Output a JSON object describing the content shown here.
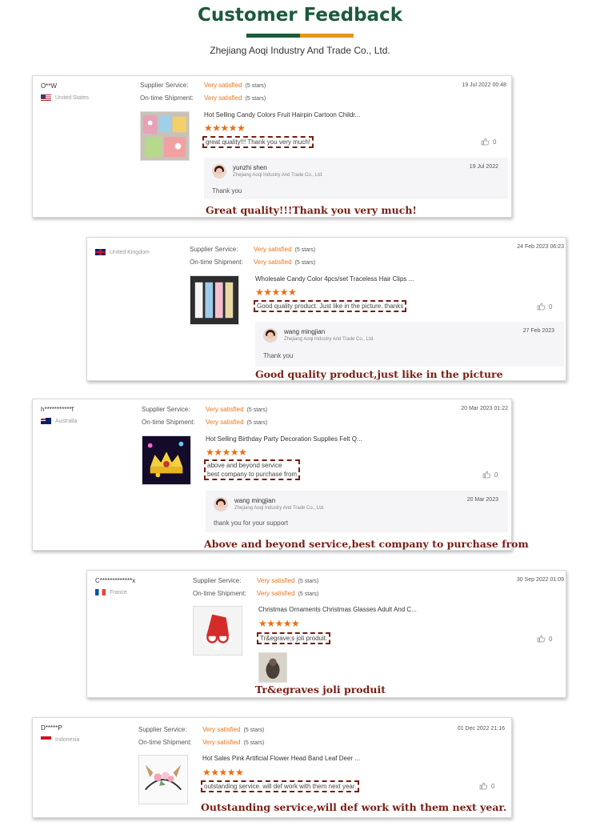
{
  "header": {
    "title": "Customer Feedback",
    "subtitle": "Zhejiang Aoqi Industry And Trade Co., Ltd.",
    "colors": {
      "green": "#1c5a3a",
      "orange": "#e8951e",
      "caption": "#7a1d12",
      "stars": "#f06d10"
    }
  },
  "service_labels": {
    "supplier": "Supplier Service:",
    "shipment": "On-time Shipment:"
  },
  "reviews": [
    {
      "user": "O**W",
      "country": "United States",
      "flag": "us-flag-icon",
      "supplier_value": "Very satisfied",
      "supplier_stars": "(5 stars)",
      "shipment_value": "Very satisfied",
      "shipment_stars": "(5 stars)",
      "date": "19 Jul 2022 00:48",
      "product": "Hot Selling Candy Colors Fruit Hairpin Cartoon Childr...",
      "rating": "★★★★★",
      "rating_value": 5,
      "text_lines": [
        "great quality!!! Thank you very much!"
      ],
      "likes": "0",
      "reply": {
        "name": "yunzhi shen",
        "company": "Zhejiang Aoqi Industry And Trade Co., Ltd.",
        "date": "19 Jul 2022",
        "text": "Thank you"
      },
      "caption": "Great quality!!!Thank you very much!"
    },
    {
      "user": "",
      "country": "United Kingdom",
      "flag": "uk-flag-icon",
      "supplier_value": "Very satisfied",
      "supplier_stars": "(5 stars)",
      "shipment_value": "Very satisfied",
      "shipment_stars": "(5 stars)",
      "date": "24 Feb 2023 06:23",
      "product": "Wholesale Candy Color 4pcs/set Traceless Hair Clips ...",
      "rating": "★★★★★",
      "rating_value": 5,
      "text_lines": [
        "Good quality product. Just like in the picture. thanks"
      ],
      "likes": "0",
      "reply": {
        "name": "wang mingjian",
        "company": "Zhejiang Aoqi Industry And Trade Co., Ltd.",
        "date": "27 Feb 2023",
        "text": "Thank you"
      },
      "caption": "Good quality product,just like in the picture"
    },
    {
      "user": "h***********f",
      "country": "Australia",
      "flag": "au-flag-icon",
      "supplier_value": "Very satisfied",
      "supplier_stars": "(5 stars)",
      "shipment_value": "Very satisfied",
      "shipment_stars": "(5 stars)",
      "date": "20 Mar 2023 01:22",
      "product": "Hot Selling Birthday Party Decoration Supplies Felt Q...",
      "rating": "★★★★★",
      "rating_value": 5,
      "text_lines": [
        "above and beyond service",
        "best company to purchase from"
      ],
      "likes": "0",
      "reply": {
        "name": "wang mingjian",
        "company": "Zhejiang Aoqi Industry And Trade Co., Ltd.",
        "date": "20 Mar 2023",
        "text": "thank you for your support"
      },
      "caption": "Above and beyond service,best company to purchase from"
    },
    {
      "user": "C*************x",
      "country": "France",
      "flag": "fr-flag-icon",
      "supplier_value": "Very satisfied",
      "supplier_stars": "(5 stars)",
      "shipment_value": "Very satisfied",
      "shipment_stars": "(5 stars)",
      "date": "30 Sep 2022 01:09",
      "product": "Christmas Ornaments Christmas Glasses Adult And C...",
      "rating": "★★★★★",
      "rating_value": 5,
      "text_lines": [
        "Tr&egrave;s joli produit."
      ],
      "likes": "0",
      "caption": "Tr&egraves joli produit"
    },
    {
      "user": "D*****P",
      "country": "Indonesia",
      "flag": "id-flag-icon",
      "supplier_value": "Very satisfied",
      "supplier_stars": "(5 stars)",
      "shipment_value": "Very satisfied",
      "shipment_stars": "(5 stars)",
      "date": "01 Dec 2022 21:16",
      "product": "Hot Sales Pink Artificial Flower Head Band Leaf Deer ...",
      "rating": "★★★★★",
      "rating_value": 5,
      "text_lines": [
        "outstanding service. will def work with them next year."
      ],
      "likes": "0",
      "caption": "Outstanding service,will def work with them next year."
    }
  ]
}
